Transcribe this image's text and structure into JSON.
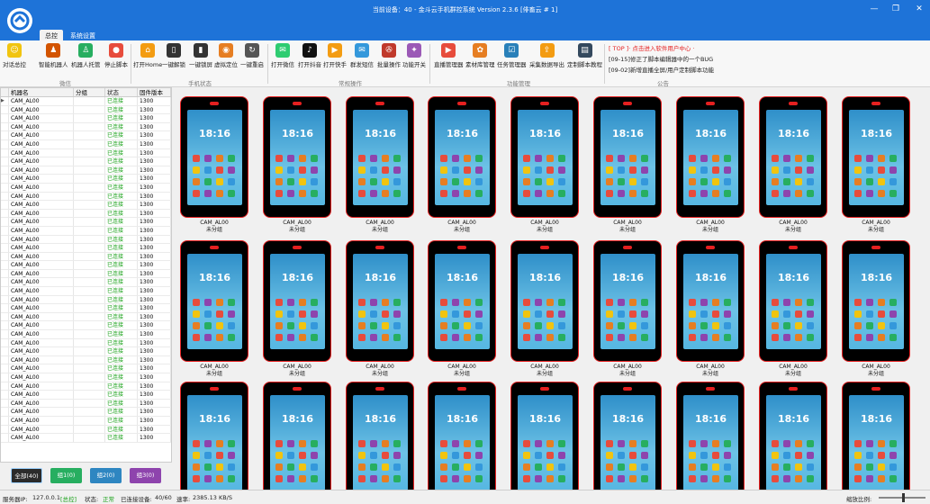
{
  "window": {
    "title": "当前设备：40 - 金斗云手机群控系统 Version 2.3.6 [俳畜云 # 1]",
    "minimize": "—",
    "restore": "❐",
    "close": "✕"
  },
  "menu": {
    "tabs": [
      "总控",
      "系统设置"
    ],
    "active": 0
  },
  "ribbon": {
    "buttons": [
      {
        "label": "对话总控",
        "icon": "smiley-icon",
        "color": "#f1c40f"
      },
      {
        "label": "智能机器人",
        "icon": "robot-icon",
        "color": "#d35400"
      },
      {
        "label": "机器人托管",
        "icon": "user-robot-icon",
        "color": "#27ae60"
      },
      {
        "label": "停止脚本",
        "icon": "stop-icon",
        "color": "#e74c3c"
      },
      {
        "label": "打开Home",
        "icon": "home-icon",
        "color": "#f39c12"
      },
      {
        "label": "一键解锁",
        "icon": "unlock-phone-icon",
        "color": "#333333"
      },
      {
        "label": "一键锁屏",
        "icon": "lock-phone-icon",
        "color": "#333333"
      },
      {
        "label": "虚拟定位",
        "icon": "location-icon",
        "color": "#e67e22"
      },
      {
        "label": "一键重启",
        "icon": "restart-icon",
        "color": "#555555"
      },
      {
        "label": "打开微信",
        "icon": "wechat-icon",
        "color": "#2ecc71"
      },
      {
        "label": "打开抖音",
        "icon": "douyin-icon",
        "color": "#111111"
      },
      {
        "label": "打开快手",
        "icon": "kuaishou-icon",
        "color": "#f39c12"
      },
      {
        "label": "群发短信",
        "icon": "sms-icon",
        "color": "#3498db"
      },
      {
        "label": "批量操作",
        "icon": "batch-icon",
        "color": "#c0392b"
      },
      {
        "label": "功能开关",
        "icon": "switch-icon",
        "color": "#9b59b6"
      },
      {
        "label": "直播管理器",
        "icon": "live-icon",
        "color": "#e74c3c"
      },
      {
        "label": "素材库管理",
        "icon": "material-icon",
        "color": "#e67e22"
      },
      {
        "label": "任务管理器",
        "icon": "task-icon",
        "color": "#2980b9"
      },
      {
        "label": "采集数据导出",
        "icon": "export-icon",
        "color": "#f39c12"
      },
      {
        "label": "定制脚本教程",
        "icon": "tutorial-icon",
        "color": "#34495e"
      }
    ],
    "groups": [
      "微信",
      "手机状态",
      "常规操作",
      "功能管理",
      "公告"
    ],
    "announcements": [
      {
        "tag": "[ TOP ]",
        "text": "· 点击进入软件用户中心 ·",
        "color": "#e52020"
      },
      {
        "tag": "[09-15]",
        "text": "修正了脚本编辑器中的一个BUG",
        "color": "#222222"
      },
      {
        "tag": "[09-02]",
        "text": "新增直播全屏/用户定制脚本功能",
        "color": "#222222"
      }
    ]
  },
  "table": {
    "headers": [
      "机器名",
      "分组",
      "状态",
      "固件版本"
    ],
    "row": {
      "name": "CAM_AL00",
      "group": "",
      "status": "已连接",
      "firmware": "1300"
    },
    "row_count": 40
  },
  "groups": [
    {
      "label": "全部(40)",
      "color": "#2b2b2b"
    },
    {
      "label": "组1(0)",
      "color": "#27ae60"
    },
    {
      "label": "组2(0)",
      "color": "#2e86c1"
    },
    {
      "label": "组3(0)",
      "color": "#8e44ad"
    }
  ],
  "phones": {
    "count": 27,
    "time": "18:16",
    "model": "CAM_AL00",
    "group": "未分组"
  },
  "status": {
    "server_label": "服务器IP:",
    "server_ip": "127.0.0.1",
    "server_role": "[总控]",
    "state_label": "状态:",
    "state": "正常",
    "connected_label": "已连接设备:",
    "connected": "40/60",
    "speed_label": "速率:",
    "speed": "2385.13 KB/S",
    "scale_label": "缩放比例:"
  }
}
